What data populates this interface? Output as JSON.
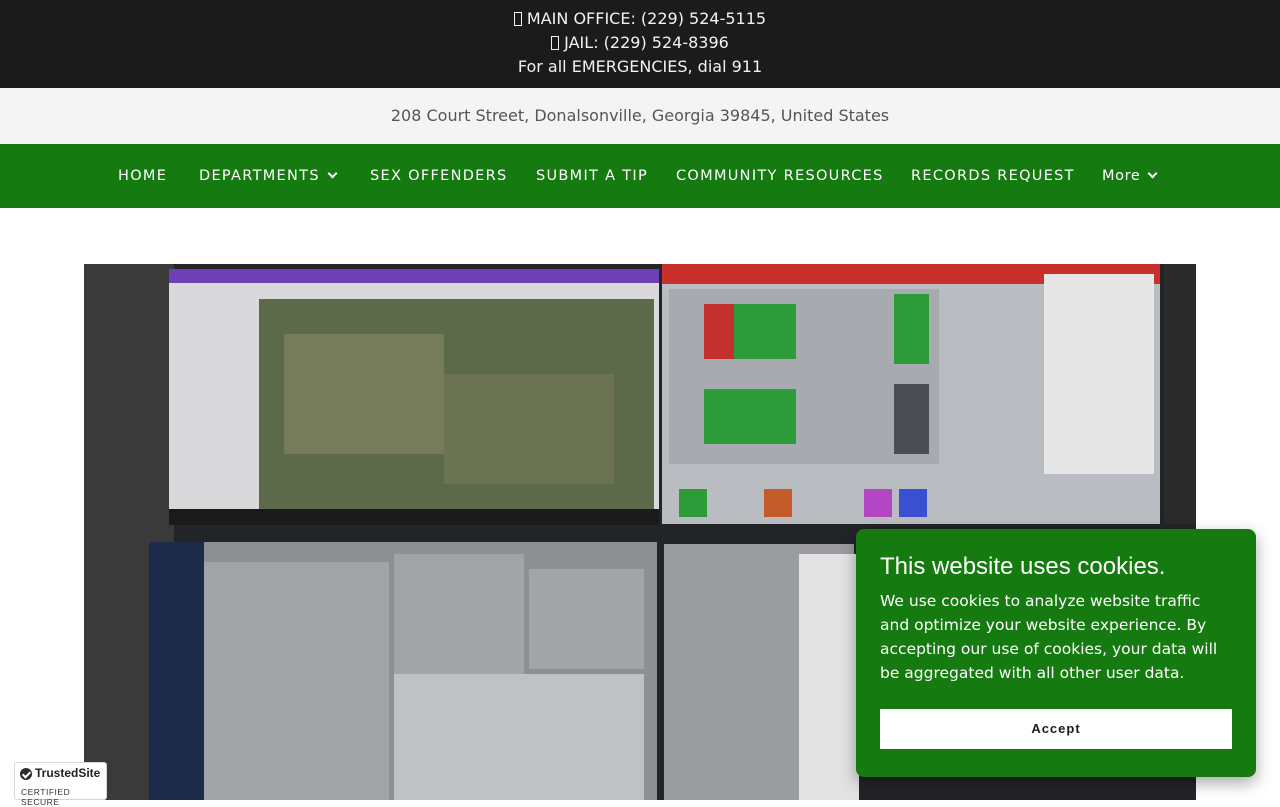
{
  "contact": {
    "main_office": "MAIN OFFICE: (229) 524-5115",
    "jail": "JAIL: (229) 524-8396",
    "emergency": "For all EMERGENCIES, dial 911"
  },
  "address": "208 Court Street, Donalsonville, Georgia 39845, United States",
  "nav": {
    "home": "HOME",
    "departments": "DEPARTMENTS",
    "sex_offenders": "SEX OFFENDERS",
    "submit_tip": "SUBMIT A TIP",
    "community_resources": "COMMUNITY RESOURCES",
    "records_request": "RECORDS REQUEST",
    "more": "More"
  },
  "cookie": {
    "title": "This website uses cookies.",
    "body": "We use cookies to analyze website traffic and optimize your website experience. By accepting our use of cookies, your data will be aggregated with all other user data.",
    "accept": "Accept"
  },
  "trust_badge": {
    "name": "TrustedSite",
    "tagline": "CERTIFIED SECURE"
  },
  "colors": {
    "top_bar": "#1b1b1b",
    "brand_green": "#157a0f",
    "address_bar": "#f4f4f4"
  },
  "icons": {
    "phone": "phone-icon",
    "chevron": "chevron-down-icon",
    "check": "check-icon"
  }
}
